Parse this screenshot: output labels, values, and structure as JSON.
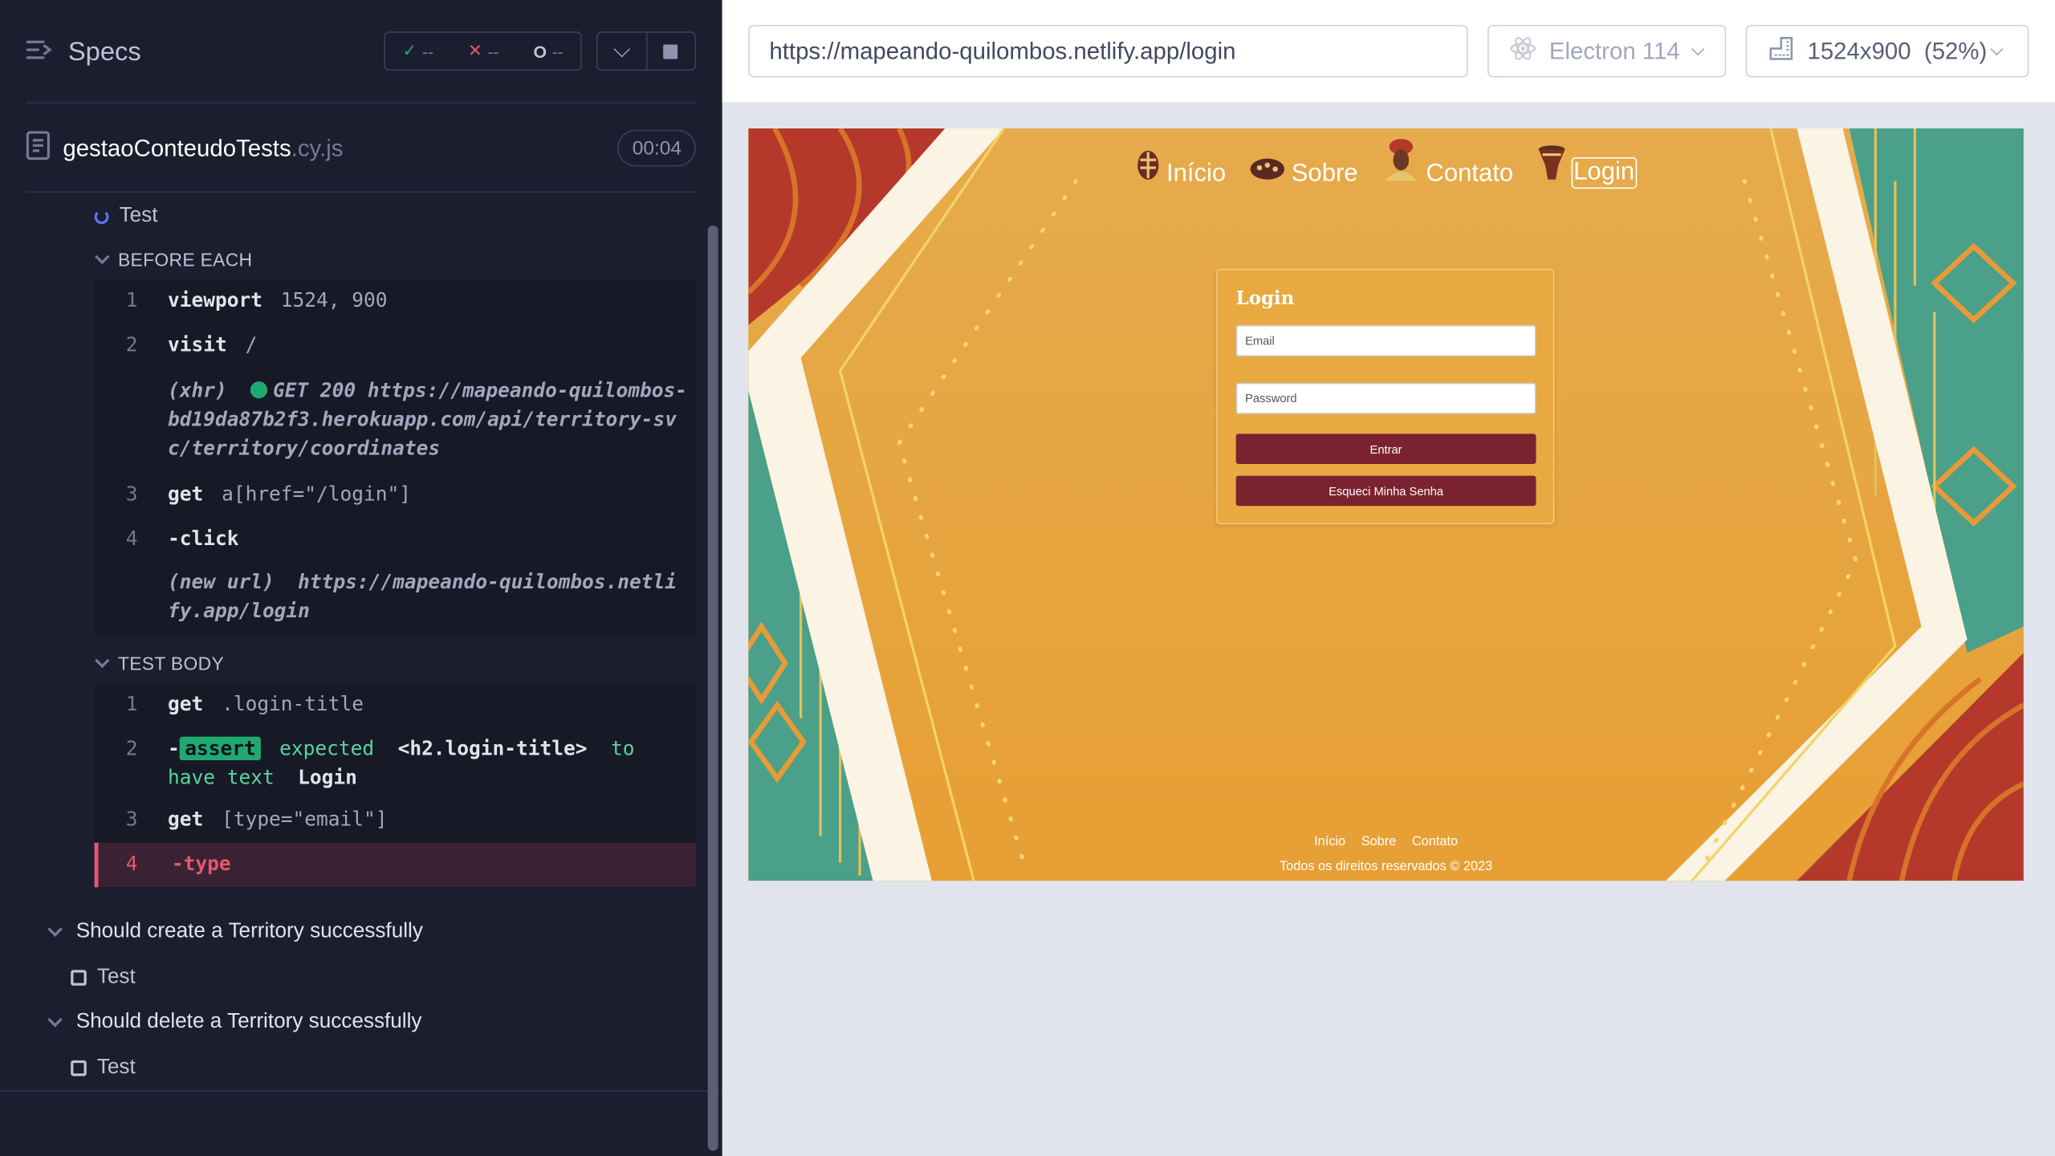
{
  "reporter": {
    "title": "Specs",
    "stats": {
      "passed": "--",
      "failed": "--",
      "pending": "--"
    },
    "spec_file": {
      "name": "gestaoConteudoTests",
      "ext": ".cy.js",
      "duration": "00:04"
    },
    "current_test": "Test",
    "before_each": {
      "label": "BEFORE EACH",
      "commands": [
        {
          "num": "1",
          "name": "viewport",
          "message": "1524, 900"
        },
        {
          "num": "2",
          "name": "visit",
          "message": "/"
        },
        {
          "num": "",
          "name": "(xhr)",
          "status": "GET 200",
          "message": "https://mapeando-quilombos-bd19da87b2f3.herokuapp.com/api/territory-svc/territory/coordinates"
        },
        {
          "num": "3",
          "name": "get",
          "message": "a[href=\"/login\"]"
        },
        {
          "num": "4",
          "name": "-click",
          "message": ""
        },
        {
          "num": "",
          "name": "(new url)",
          "message": "https://mapeando-quilombos.netlify.app/login"
        }
      ]
    },
    "test_body": {
      "label": "TEST BODY",
      "commands": [
        {
          "num": "1",
          "name": "get",
          "message": ".login-title"
        },
        {
          "num": "2",
          "name": "-assert",
          "badge": "assert",
          "expected": "expected",
          "subject": "<h2.login-title>",
          "to_have": "to have",
          "text_word": "text",
          "value": "Login"
        },
        {
          "num": "3",
          "name": "get",
          "message": "[type=\"email\"]"
        },
        {
          "num": "4",
          "name": "-type",
          "message": ""
        }
      ]
    },
    "suites": [
      {
        "title": "Should create a Territory successfully",
        "test": "Test"
      },
      {
        "title": "Should delete a Territory successfully",
        "test": "Test"
      }
    ]
  },
  "browser_bar": {
    "url": "https://mapeando-quilombos.netlify.app/login",
    "browser": "Electron 114",
    "viewport": "1524x900",
    "scale": "(52%)"
  },
  "app": {
    "nav": [
      {
        "label": "Início",
        "icon": "shield-mask-icon"
      },
      {
        "label": "Sobre",
        "icon": "drum-top-icon"
      },
      {
        "label": "Contato",
        "icon": "woman-head-icon"
      },
      {
        "label": "Login",
        "icon": "djembe-drum-icon",
        "active": true
      }
    ],
    "login": {
      "title": "Login",
      "email_placeholder": "Email",
      "password_placeholder": "Password",
      "submit": "Entrar",
      "forgot": "Esqueci Minha Senha"
    },
    "footer": {
      "links": [
        "Início",
        "Sobre",
        "Contato"
      ],
      "copyright": "Todos os direitos reservados © 2023"
    }
  },
  "colors": {
    "reporter_bg": "#1b1e2e",
    "pass": "#1fa971",
    "fail": "#e45770",
    "app_orange": "#e8a940",
    "app_button": "#7b2230",
    "app_teal": "#4aa088",
    "app_red": "#b5392a"
  }
}
